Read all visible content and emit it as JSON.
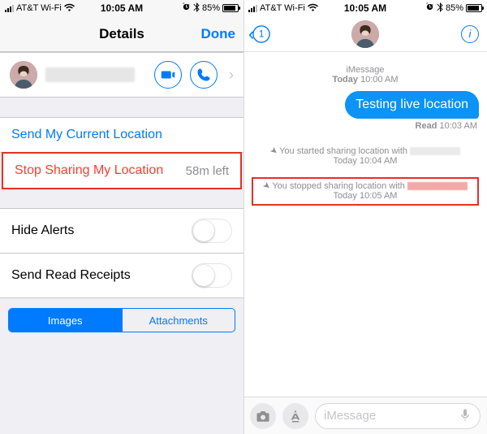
{
  "status": {
    "carrier": "AT&T Wi-Fi",
    "time": "10:05 AM",
    "battery_pct": "85%",
    "bt_icon": "bluetooth",
    "alarm_icon": "alarm",
    "wifi_icon": "wifi"
  },
  "left": {
    "nav": {
      "title": "Details",
      "done": "Done"
    },
    "send_current": "Send My Current Location",
    "stop_sharing": "Stop Sharing My Location",
    "time_left": "58m left",
    "hide_alerts": "Hide Alerts",
    "read_receipts": "Send Read Receipts",
    "seg_images": "Images",
    "seg_attachments": "Attachments",
    "video_icon": "video",
    "phone_icon": "phone"
  },
  "right": {
    "back_count": "1",
    "info_glyph": "i",
    "header_l1": "iMessage",
    "header_l2a": "Today",
    "header_l2b": "10:00 AM",
    "bubble_text": "Testing live location",
    "read_label": "Read",
    "read_time": "10:03 AM",
    "sys1_text": "You started sharing location with",
    "sys1_day": "Today",
    "sys1_time": "10:04 AM",
    "sys2_text": "You stopped sharing location with",
    "sys2_day": "Today",
    "sys2_time": "10:05 AM",
    "loc_arrow": "➤",
    "placeholder": "iMessage"
  }
}
